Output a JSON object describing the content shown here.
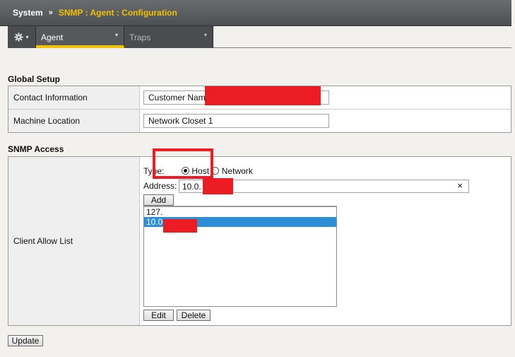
{
  "breadcrumb": {
    "root": "System",
    "separator": "»",
    "path": "SNMP : Agent : Configuration"
  },
  "tabs": {
    "gear_caret": "▾",
    "items": [
      {
        "label": "Agent",
        "caret": "▾",
        "active": true
      },
      {
        "label": "Traps",
        "caret": "▾",
        "active": false
      }
    ]
  },
  "global_setup": {
    "title": "Global Setup",
    "contact_label": "Contact Information",
    "contact_value": "Customer Nam",
    "location_label": "Machine Location",
    "location_value": "Network Closet 1"
  },
  "snmp_access": {
    "title": "SNMP Access",
    "client_allow_label": "Client Allow List",
    "type_label": "Type:",
    "type_options": [
      {
        "label": "Host",
        "selected": true
      },
      {
        "label": "Network",
        "selected": false
      }
    ],
    "address_label": "Address:",
    "address_value": "10.0.",
    "clear_symbol": "×",
    "add_button": "Add",
    "list_items": [
      {
        "text": "127.",
        "selected": false
      },
      {
        "text": "10.0",
        "selected": true
      }
    ],
    "edit_button": "Edit",
    "delete_button": "Delete"
  },
  "update_button": "Update",
  "colors": {
    "accent": "#f2c200",
    "selection": "#2b8fd8",
    "redaction": "#ec1c24"
  }
}
